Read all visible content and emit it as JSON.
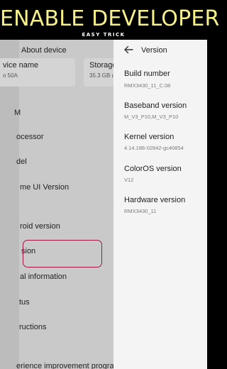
{
  "banner": {
    "title": "ENABLE DEVELOPER",
    "subtitle": "EASY TRICK"
  },
  "left_panel": {
    "back_icon": "back-arrow-icon",
    "title": "About device",
    "cards": [
      {
        "label": "vice name",
        "value": "o 50A"
      },
      {
        "label": "Storage",
        "value": "35.3 GB u"
      }
    ],
    "items": [
      "M",
      "ocessor",
      "del",
      "me UI Version",
      "roid version",
      "sion",
      "al information",
      "tus",
      "ructions",
      "erience improvement progra"
    ],
    "highlight_color": "#a31545"
  },
  "right_panel": {
    "back_icon": "back-arrow-icon",
    "title": "Version",
    "items": [
      {
        "label": "Build number",
        "value": "RMX3430_11_C.08"
      },
      {
        "label": "Baseband version",
        "value": "M_V3_P10,M_V3_P10"
      },
      {
        "label": "Kernel version",
        "value": "4.14.186-02842-gc40854"
      },
      {
        "label": "ColorOS version",
        "value": "V12"
      },
      {
        "label": "Hardware version",
        "value": "RMX3430_11"
      }
    ]
  }
}
